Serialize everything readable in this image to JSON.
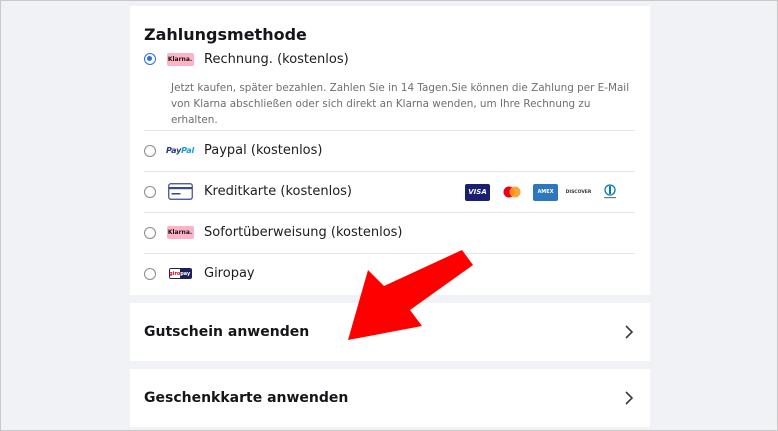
{
  "payment": {
    "title": "Zahlungsmethode",
    "klarna_description": "Jetzt kaufen, später bezahlen. Zahlen Sie in 14 Tagen.Sie können die Zahlung per E-Mail von Klarna abschließen oder sich direkt an Klarna wenden, um Ihre Rechnung zu erhalten.",
    "options": [
      {
        "label": "Rechnung. (kostenlos)",
        "icon": "klarna-logo",
        "logo_text": "Klarna.",
        "selected": true
      },
      {
        "label": "Paypal (kostenlos)",
        "icon": "paypal-logo",
        "logo_text_1": "Pay",
        "logo_text_2": "Pal",
        "selected": false
      },
      {
        "label": "Kreditkarte (kostenlos)",
        "icon": "credit-card-icon",
        "selected": false
      },
      {
        "label": "Sofortüberweisung (kostenlos)",
        "icon": "klarna-logo",
        "logo_text": "Klarna.",
        "selected": false
      },
      {
        "label": "Giropay",
        "icon": "giropay-logo",
        "logo_text_1": "giro",
        "logo_text_2": "pay",
        "selected": false
      }
    ],
    "card_brands": {
      "visa": "VISA",
      "mastercard": "mastercard",
      "amex": "AMEX",
      "discover": "DISCOVER",
      "diners": "Diners Club"
    }
  },
  "voucher": {
    "label": "Gutschein anwenden"
  },
  "giftcard": {
    "label": "Geschenkkarte anwenden"
  },
  "colors": {
    "accent": "#2a6fdb",
    "background": "#f1f2f5",
    "card": "#ffffff",
    "annotation_arrow": "#ff0000"
  }
}
